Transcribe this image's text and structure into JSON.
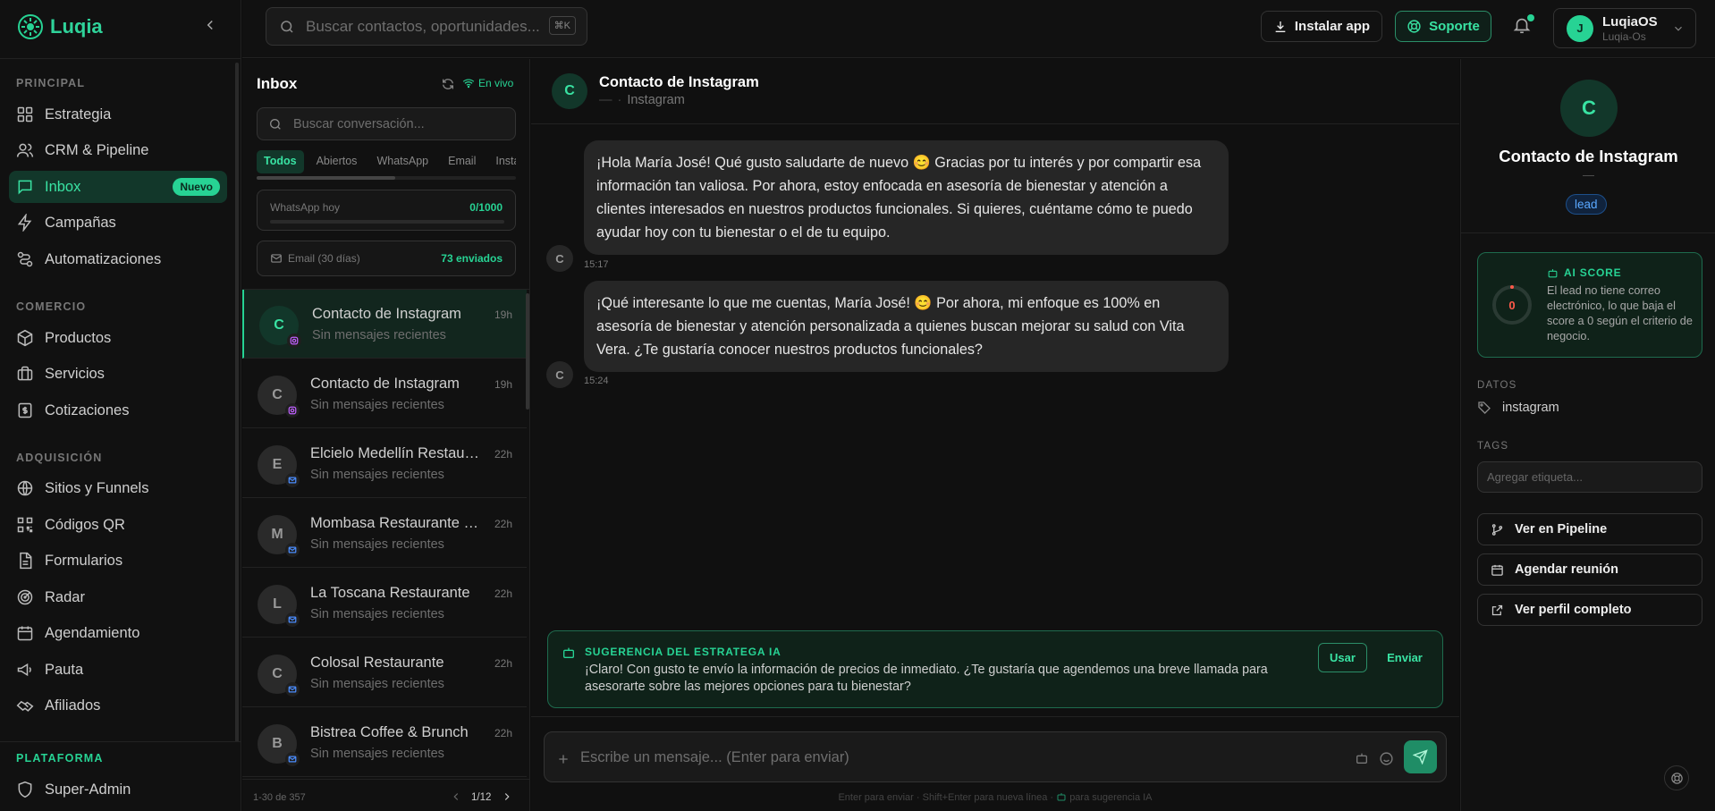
{
  "app": {
    "name": "Luqia",
    "accent": "#27d394"
  },
  "sidebar": {
    "sections": [
      {
        "label": "PRINCIPAL",
        "items": [
          {
            "label": "Estrategia",
            "icon": "grid-icon"
          },
          {
            "label": "CRM & Pipeline",
            "icon": "users-icon"
          },
          {
            "label": "Inbox",
            "icon": "message-icon",
            "active": true,
            "badge": "Nuevo"
          },
          {
            "label": "Campañas",
            "icon": "zap-icon"
          },
          {
            "label": "Automatizaciones",
            "icon": "workflow-icon"
          }
        ]
      },
      {
        "label": "COMERCIO",
        "items": [
          {
            "label": "Productos",
            "icon": "box-icon"
          },
          {
            "label": "Servicios",
            "icon": "briefcase-icon"
          },
          {
            "label": "Cotizaciones",
            "icon": "receipt-icon"
          }
        ]
      },
      {
        "label": "ADQUISICIÓN",
        "items": [
          {
            "label": "Sitios y Funnels",
            "icon": "globe-icon"
          },
          {
            "label": "Códigos QR",
            "icon": "qr-icon"
          },
          {
            "label": "Formularios",
            "icon": "file-icon"
          },
          {
            "label": "Radar",
            "icon": "radar-icon"
          },
          {
            "label": "Agendamiento",
            "icon": "calendar-icon"
          },
          {
            "label": "Pauta",
            "icon": "megaphone-icon"
          },
          {
            "label": "Afiliados",
            "icon": "handshake-icon"
          }
        ]
      }
    ],
    "platform": {
      "label": "PLATAFORMA",
      "item": "Super-Admin"
    }
  },
  "header": {
    "search_placeholder": "Buscar contactos, oportunidades...",
    "shortcut": "⌘K",
    "install_label": "Instalar app",
    "support_label": "Soporte",
    "user": {
      "initial": "J",
      "name": "LuqiaOS",
      "org": "Luqia-Os"
    }
  },
  "inbox": {
    "title": "Inbox",
    "live_label": "En vivo",
    "search_placeholder": "Buscar conversación...",
    "filters": [
      "Todos",
      "Abiertos",
      "WhatsApp",
      "Email",
      "Instagram"
    ],
    "whatsapp_stat": {
      "label": "WhatsApp hoy",
      "value": "0/1000",
      "fill": 0
    },
    "email_stat": {
      "label": "Email (30 días)",
      "value": "73 enviados"
    },
    "conversations": [
      {
        "initial": "C",
        "name": "Contacto de Instagram",
        "time": "19h",
        "preview": "Sin mensajes recientes",
        "channel": "instagram",
        "active": true
      },
      {
        "initial": "C",
        "name": "Contacto de Instagram",
        "time": "19h",
        "preview": "Sin mensajes recientes",
        "channel": "instagram"
      },
      {
        "initial": "E",
        "name": "Elcielo Medellín Restaurante",
        "time": "22h",
        "preview": "Sin mensajes recientes",
        "channel": "email"
      },
      {
        "initial": "M",
        "name": "Mombasa Restaurante Medellín",
        "time": "22h",
        "preview": "Sin mensajes recientes",
        "channel": "email"
      },
      {
        "initial": "L",
        "name": "La Toscana Restaurante",
        "time": "22h",
        "preview": "Sin mensajes recientes",
        "channel": "email"
      },
      {
        "initial": "C",
        "name": "Colosal Restaurante",
        "time": "22h",
        "preview": "Sin mensajes recientes",
        "channel": "email"
      },
      {
        "initial": "B",
        "name": "Bistrea Coffee & Brunch",
        "time": "22h",
        "preview": "Sin mensajes recientes",
        "channel": "email"
      }
    ],
    "pager": {
      "range": "1-30 de 357",
      "page": "1/12"
    }
  },
  "chat": {
    "contact_initial": "C",
    "contact_name": "Contacto de Instagram",
    "contact_dash": "—",
    "contact_channel": "Instagram",
    "messages": [
      {
        "text": "¡Hola María José! Qué gusto saludarte de nuevo 😊 Gracias por tu interés y por compartir esa información tan valiosa. Por ahora, estoy enfocada en asesoría de bienestar y atención a clientes interesados en nuestros productos funcionales. Si quieres, cuéntame cómo te puedo ayudar hoy con tu bienestar o el de tu equipo.",
        "time": "15:17"
      },
      {
        "text": "¡Qué interesante lo que me cuentas, María José! 😊 Por ahora, mi enfoque es 100% en asesoría de bienestar y atención personalizada a quienes buscan mejorar su salud con Vita Vera. ¿Te gustaría conocer nuestros productos funcionales?",
        "time": "15:24"
      }
    ],
    "suggestion": {
      "title": "SUGERENCIA DEL ESTRATEGA IA",
      "text": "¡Claro! Con gusto te envío la información de precios de inmediato. ¿Te gustaría que agendemos una breve llamada para asesorarte sobre las mejores opciones para tu bienestar?",
      "use_label": "Usar",
      "send_label": "Enviar"
    },
    "composer_placeholder": "Escribe un mensaje... (Enter para enviar)",
    "hint_before": "Enter para enviar · Shift+Enter para nueva línea ·",
    "hint_after": "para sugerencia IA"
  },
  "contact_panel": {
    "initial": "C",
    "name": "Contacto de Instagram",
    "dash": "—",
    "tag": "lead",
    "ai_score": {
      "title": "AI SCORE",
      "score": "0",
      "text": "El lead no tiene correo electrónico, lo que baja el score a 0 según el criterio de negocio."
    },
    "data_label": "DATOS",
    "source": "instagram",
    "tags_label": "TAGS",
    "tag_placeholder": "Agregar etiqueta...",
    "actions": [
      "Ver en Pipeline",
      "Agendar reunión",
      "Ver perfil completo"
    ]
  }
}
